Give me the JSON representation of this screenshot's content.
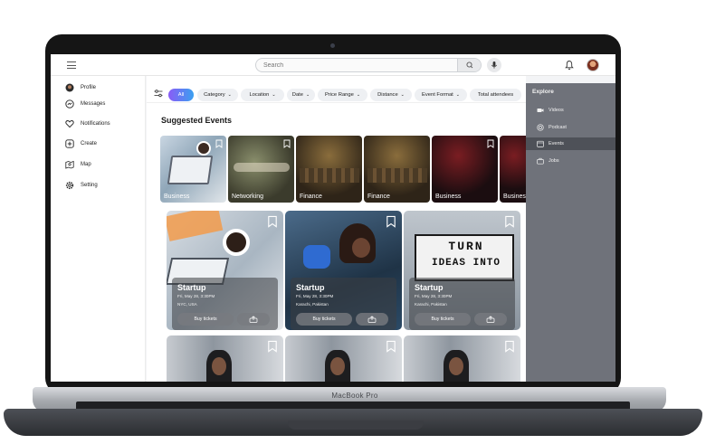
{
  "app": {
    "search": {
      "placeholder": "Search"
    },
    "device_label": "MacBook Pro"
  },
  "sidebar": {
    "items": [
      {
        "label": "Profile",
        "icon": "profile-avatar-icon"
      },
      {
        "label": "Messages",
        "icon": "messenger-icon"
      },
      {
        "label": "Notifications",
        "icon": "heart-icon"
      },
      {
        "label": "Create",
        "icon": "plus-square-icon"
      },
      {
        "label": "Map",
        "icon": "map-icon"
      },
      {
        "label": "Setting",
        "icon": "gear-icon"
      }
    ]
  },
  "explore": {
    "title": "Explore",
    "items": [
      {
        "label": "Videos",
        "icon": "video-icon",
        "active": false
      },
      {
        "label": "Podcast",
        "icon": "podcast-icon",
        "active": false
      },
      {
        "label": "Events",
        "icon": "calendar-icon",
        "active": true
      },
      {
        "label": "Jobs",
        "icon": "briefcase-icon",
        "active": false
      }
    ]
  },
  "filters": {
    "chips": [
      "All",
      "Category",
      "Location",
      "Date",
      "Price Range",
      "Distance",
      "Event Format",
      "Total attendees"
    ]
  },
  "main": {
    "section_title": "Suggested Events",
    "categories": [
      "Business",
      "Networking",
      "Finance",
      "Finance",
      "Business",
      "Business"
    ],
    "events": [
      {
        "title": "Startup",
        "date": "Fri, May 28, 3:30PM",
        "location": "NYC, USA",
        "cta": "Buy tickets"
      },
      {
        "title": "Startup",
        "date": "Fri, May 28, 3:30PM",
        "location": "Karachi, Pakistan",
        "cta": "Buy tickets"
      },
      {
        "title": "Startup",
        "date": "Fri, May 28, 3:30PM",
        "location": "Karachi, Pakistan",
        "cta": "Buy tickets"
      }
    ],
    "sign_text": [
      "TURN",
      "IDEAS INTO"
    ]
  },
  "colors": {
    "accent_gradient_start": "#8a5cf6",
    "accent_gradient_end": "#3aa0f0",
    "explore_panel": "#6f727a",
    "explore_active": "#4e5158"
  }
}
